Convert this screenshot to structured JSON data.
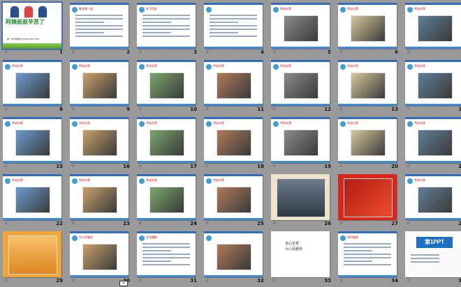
{
  "app": {
    "view": "slide-sorter"
  },
  "slides": [
    {
      "num": "1",
      "kind": "title",
      "title": "阿姨叔叔辛苦了",
      "note": "第一PPT模板网 WWW.1PPT.COM"
    },
    {
      "num": "2",
      "kind": "text",
      "header": "歌本意一段"
    },
    {
      "num": "3",
      "kind": "text",
      "header": "学习目标"
    },
    {
      "num": "4",
      "kind": "text",
      "header": ""
    },
    {
      "num": "5",
      "kind": "photo",
      "header": "劳动光荣"
    },
    {
      "num": "6",
      "kind": "photo",
      "header": "劳动光荣"
    },
    {
      "num": "7",
      "kind": "photo",
      "header": "劳动光荣"
    },
    {
      "num": "8",
      "kind": "photo",
      "header": "劳动光荣"
    },
    {
      "num": "9",
      "kind": "photo",
      "header": "劳动光荣"
    },
    {
      "num": "10",
      "kind": "photo",
      "header": "劳动光荣"
    },
    {
      "num": "11",
      "kind": "photo",
      "header": "劳动光荣"
    },
    {
      "num": "12",
      "kind": "photo",
      "header": "劳动光荣"
    },
    {
      "num": "13",
      "kind": "photo",
      "header": "劳动光荣"
    },
    {
      "num": "14",
      "kind": "photo",
      "header": "劳动光荣"
    },
    {
      "num": "15",
      "kind": "photo",
      "header": "劳动光荣"
    },
    {
      "num": "16",
      "kind": "photo",
      "header": "劳动光荣"
    },
    {
      "num": "17",
      "kind": "photo",
      "header": "劳动光荣"
    },
    {
      "num": "18",
      "kind": "photo",
      "header": "劳动光荣"
    },
    {
      "num": "19",
      "kind": "photo",
      "header": "劳动光荣"
    },
    {
      "num": "20",
      "kind": "photo",
      "header": "劳动光荣"
    },
    {
      "num": "21",
      "kind": "photo",
      "header": "劳动光荣"
    },
    {
      "num": "22",
      "kind": "photo",
      "header": "劳动光荣"
    },
    {
      "num": "23",
      "kind": "photo",
      "header": "劳动光荣"
    },
    {
      "num": "24",
      "kind": "photo",
      "header": "劳动光荣"
    },
    {
      "num": "25",
      "kind": "photo",
      "header": "劳动光荣"
    },
    {
      "num": "26",
      "kind": "dark",
      "header": ""
    },
    {
      "num": "27",
      "kind": "red",
      "header": ""
    },
    {
      "num": "28",
      "kind": "photo",
      "header": "劳动光荣"
    },
    {
      "num": "29",
      "kind": "orange",
      "header": ""
    },
    {
      "num": "30",
      "kind": "photo",
      "header": "为人民服务"
    },
    {
      "num": "31",
      "kind": "text",
      "header": "文化播报"
    },
    {
      "num": "32",
      "kind": "photo",
      "header": ""
    },
    {
      "num": "33",
      "kind": "hand",
      "header": "",
      "lines": [
        "全心全意",
        "为人民服务"
      ]
    },
    {
      "num": "34",
      "kind": "text",
      "header": "知识链接"
    },
    {
      "num": "35",
      "kind": "logo",
      "header": "",
      "logo": "第1PPT"
    }
  ],
  "colors": {
    "background": "#9a9a9a",
    "band": "#2d6cc0",
    "selection": "#4a6fb5"
  }
}
